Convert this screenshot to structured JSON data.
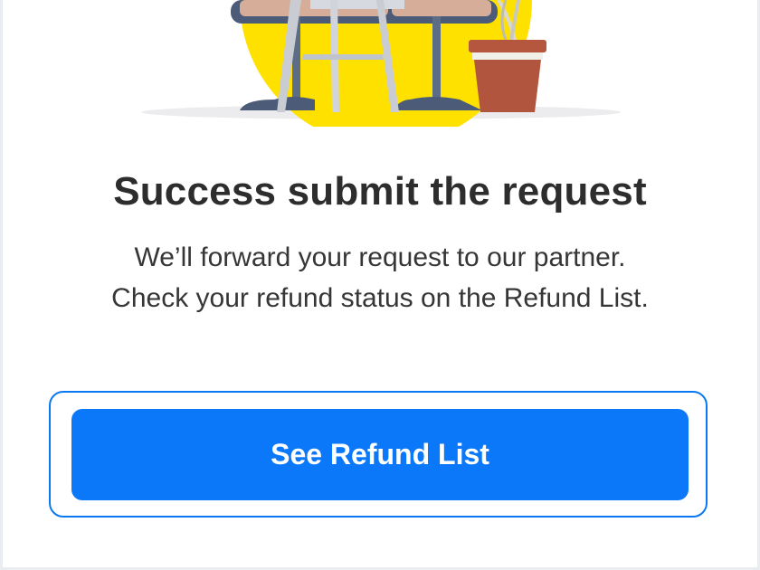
{
  "success": {
    "title": "Success submit the request",
    "message_line1": "We’ll forward your request to our partner.",
    "message_line2": "Check your refund status on the Refund List.",
    "button_label": "See Refund List"
  },
  "colors": {
    "accent": "#0a78f8",
    "sun": "#ffe100",
    "text": "#2d2d2d"
  }
}
